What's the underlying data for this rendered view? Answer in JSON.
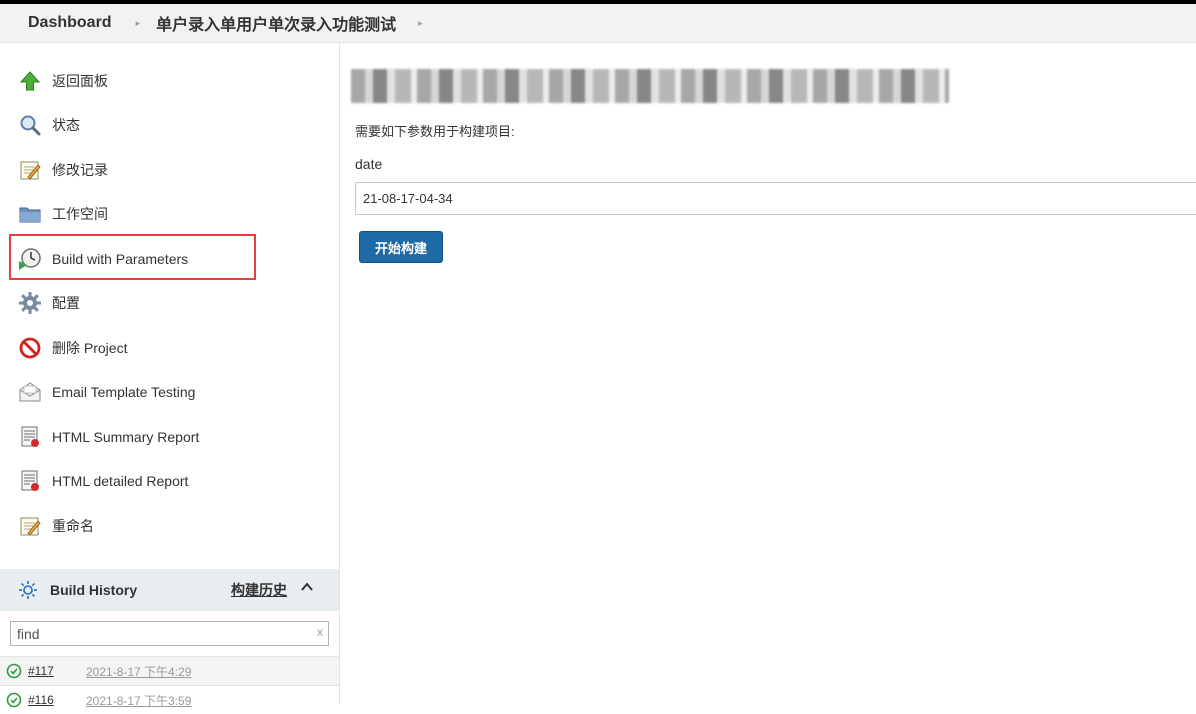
{
  "breadcrumb": {
    "dashboard": "Dashboard",
    "project": "单户录入单用户单次录入功能测试",
    "separator": "▸"
  },
  "sidebar": {
    "items": [
      {
        "label": "返回面板",
        "icon": "up-arrow-icon"
      },
      {
        "label": "状态",
        "icon": "magnifier-icon"
      },
      {
        "label": "修改记录",
        "icon": "notepad-icon"
      },
      {
        "label": "工作空间",
        "icon": "folder-icon"
      },
      {
        "label": "Build with Parameters",
        "icon": "clock-play-icon"
      },
      {
        "label": "配置",
        "icon": "gear-icon"
      },
      {
        "label": "删除 Project",
        "icon": "no-entry-icon"
      },
      {
        "label": "Email Template Testing",
        "icon": "envelope-icon"
      },
      {
        "label": "HTML Summary Report",
        "icon": "report-icon"
      },
      {
        "label": "HTML detailed Report",
        "icon": "report-icon"
      },
      {
        "label": "重命名",
        "icon": "notepad-icon"
      }
    ],
    "highlight_color": "#e04040"
  },
  "build_history": {
    "title": "Build History",
    "trend_link": "构建历史",
    "search_placeholder": "find",
    "clear": "x",
    "builds": [
      {
        "number": "#117",
        "time": "2021-8-17 下午4:29",
        "status": "success"
      },
      {
        "number": "#116",
        "time": "2021-8-17 下午3:59",
        "status": "success"
      }
    ]
  },
  "main": {
    "description": "需要如下参数用于构建项目:",
    "parameter": {
      "name": "date",
      "value": "21-08-17-04-34"
    },
    "build_button": "开始构建",
    "accent": "#1f6aa5"
  }
}
